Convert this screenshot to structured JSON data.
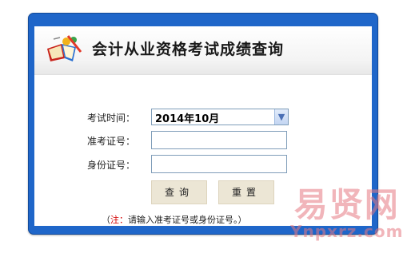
{
  "header": {
    "title": "会计从业资格考试成绩查询"
  },
  "form": {
    "exam_time_label": "考试时间：",
    "exam_time_value": "2014年10月",
    "ticket_label": "准考证号：",
    "ticket_value": "",
    "id_label": "身份证号：",
    "id_value": ""
  },
  "buttons": {
    "query_label": "查询",
    "reset_label": "重置"
  },
  "note": {
    "prefix": "（",
    "highlight": "注：",
    "text": "请输入准考证号或身份证号。）"
  },
  "watermark": {
    "brand_cn": "易贤网",
    "brand_url": "Ynpxrz.com"
  },
  "colors": {
    "frame": "#1f66c9",
    "button_bg": "#ece6d5",
    "note_highlight": "#d40000"
  },
  "icons": {
    "logo": "book-pencil-icon",
    "select_arrow": "chevron-down-icon"
  }
}
